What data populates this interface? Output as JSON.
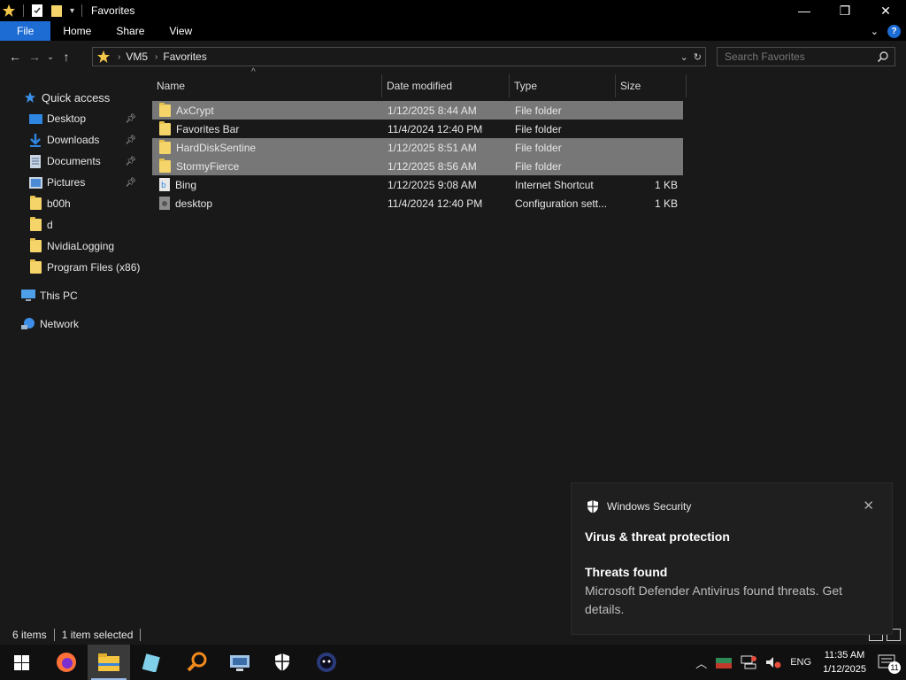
{
  "window": {
    "title": "Favorites",
    "minimize": "—",
    "maximize": "❐",
    "close": "✕"
  },
  "ribbon": {
    "tabs": [
      "File",
      "Home",
      "Share",
      "View"
    ]
  },
  "address": {
    "crumbs": [
      "VM5",
      "Favorites"
    ],
    "search_placeholder": "Search Favorites"
  },
  "nav": {
    "quick_access": "Quick access",
    "items": [
      {
        "label": "Desktop",
        "icon": "desktop-icon",
        "pinned": true
      },
      {
        "label": "Downloads",
        "icon": "downloads-icon",
        "pinned": true
      },
      {
        "label": "Documents",
        "icon": "documents-icon",
        "pinned": true
      },
      {
        "label": "Pictures",
        "icon": "pictures-icon",
        "pinned": true
      },
      {
        "label": "b00h",
        "icon": "folder-icon",
        "pinned": false
      },
      {
        "label": "d",
        "icon": "folder-icon",
        "pinned": false
      },
      {
        "label": "NvidiaLogging",
        "icon": "folder-icon",
        "pinned": false
      },
      {
        "label": "Program Files (x86)",
        "icon": "folder-icon",
        "pinned": false
      }
    ],
    "this_pc": "This PC",
    "network": "Network"
  },
  "columns": [
    "Name",
    "Date modified",
    "Type",
    "Size"
  ],
  "files": [
    {
      "name": "AxCrypt",
      "date": "1/12/2025 8:44 AM",
      "type": "File folder",
      "size": "",
      "icon": "folder-icon",
      "selected": true
    },
    {
      "name": "Favorites Bar",
      "date": "11/4/2024 12:40 PM",
      "type": "File folder",
      "size": "",
      "icon": "folder-icon",
      "selected": false
    },
    {
      "name": "HardDiskSentine",
      "date": "1/12/2025 8:51 AM",
      "type": "File folder",
      "size": "",
      "icon": "folder-icon",
      "selected": true
    },
    {
      "name": "StormyFierce",
      "date": "1/12/2025 8:56 AM",
      "type": "File folder",
      "size": "",
      "icon": "folder-icon",
      "selected": true
    },
    {
      "name": "Bing",
      "date": "1/12/2025 9:08 AM",
      "type": "Internet Shortcut",
      "size": "1 KB",
      "icon": "shortcut-icon",
      "selected": false
    },
    {
      "name": "desktop",
      "date": "11/4/2024 12:40 PM",
      "type": "Configuration sett...",
      "size": "1 KB",
      "icon": "config-file-icon",
      "selected": false
    }
  ],
  "status": {
    "count": "6 items",
    "selected": "1 item selected"
  },
  "toast": {
    "app": "Windows Security",
    "heading": "Virus & threat protection",
    "title": "Threats found",
    "body": "Microsoft Defender Antivirus found threats. Get details."
  },
  "taskbar": {
    "apps": [
      "start-icon",
      "firefox-icon",
      "file-explorer-icon",
      "notepad-icon",
      "search-app-icon",
      "remote-desktop-icon",
      "windows-security-icon",
      "app-icon"
    ],
    "language": "ENG",
    "time": "11:35 AM",
    "date": "1/12/2025",
    "notification_count": "11"
  }
}
